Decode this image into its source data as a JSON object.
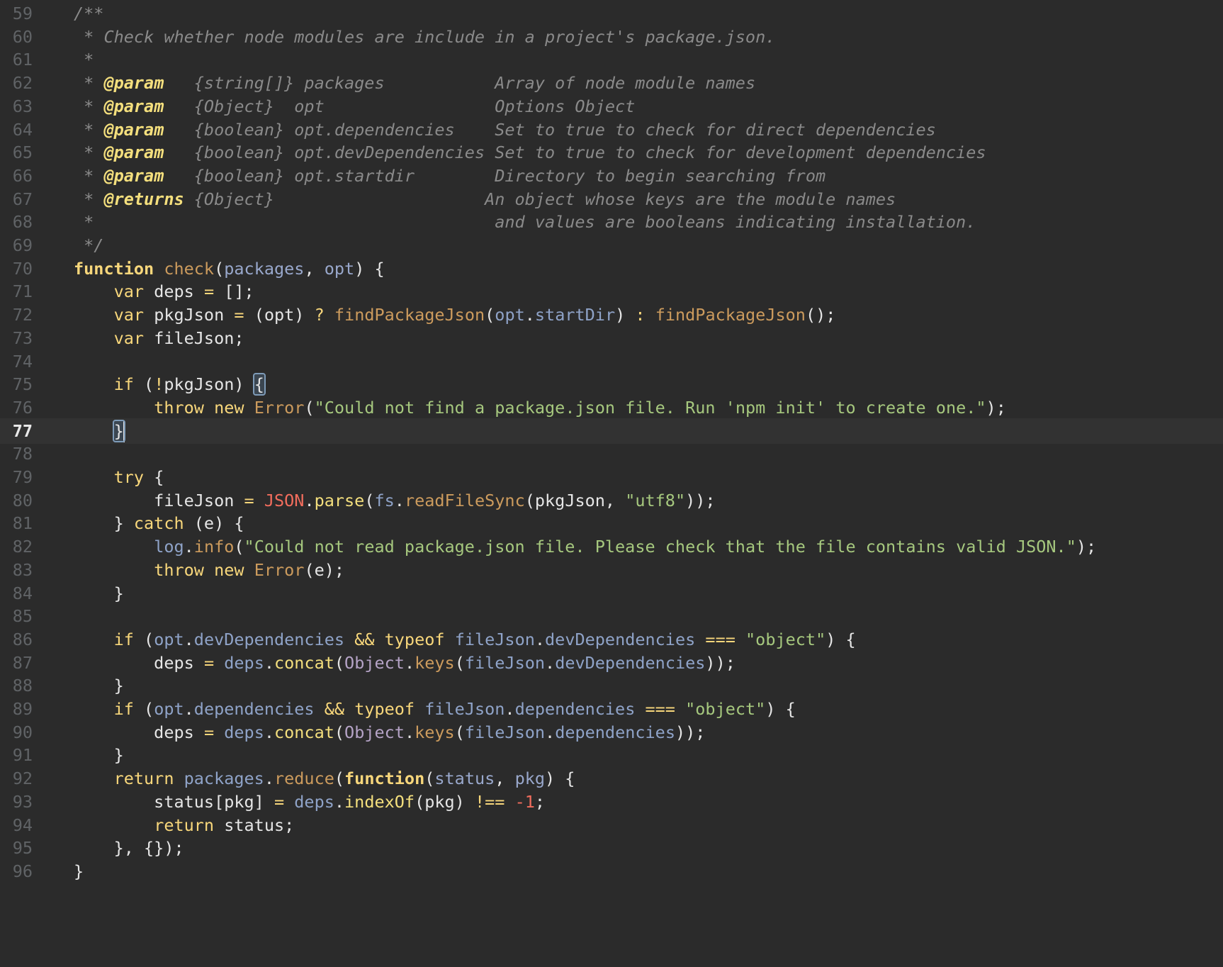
{
  "editor": {
    "current_line": 77,
    "lines": [
      {
        "n": 59,
        "tokens": [
          [
            "cmt",
            "/**"
          ]
        ]
      },
      {
        "n": 60,
        "tokens": [
          [
            "cmt",
            " * Check whether node modules are include in a project's package.json."
          ]
        ]
      },
      {
        "n": 61,
        "tokens": [
          [
            "cmt",
            " *"
          ]
        ]
      },
      {
        "n": 62,
        "tokens": [
          [
            "cmt",
            " * "
          ],
          [
            "tag",
            "@param"
          ],
          [
            "cmt",
            "   {string[]} packages           Array of node module names"
          ]
        ]
      },
      {
        "n": 63,
        "tokens": [
          [
            "cmt",
            " * "
          ],
          [
            "tag",
            "@param"
          ],
          [
            "cmt",
            "   {Object}  opt                 Options Object"
          ]
        ]
      },
      {
        "n": 64,
        "tokens": [
          [
            "cmt",
            " * "
          ],
          [
            "tag",
            "@param"
          ],
          [
            "cmt",
            "   {boolean} opt.dependencies    Set to true to check for direct dependencies"
          ]
        ]
      },
      {
        "n": 65,
        "tokens": [
          [
            "cmt",
            " * "
          ],
          [
            "tag",
            "@param"
          ],
          [
            "cmt",
            "   {boolean} opt.devDependencies Set to true to check for development dependencies"
          ]
        ]
      },
      {
        "n": 66,
        "tokens": [
          [
            "cmt",
            " * "
          ],
          [
            "tag",
            "@param"
          ],
          [
            "cmt",
            "   {boolean} opt.startdir        Directory to begin searching from"
          ]
        ]
      },
      {
        "n": 67,
        "tokens": [
          [
            "cmt",
            " * "
          ],
          [
            "tag",
            "@returns"
          ],
          [
            "cmt",
            " {Object}                     An object whose keys are the module names"
          ]
        ]
      },
      {
        "n": 68,
        "tokens": [
          [
            "cmt",
            " *                                        and values are booleans indicating installation."
          ]
        ]
      },
      {
        "n": 69,
        "tokens": [
          [
            "cmt",
            " */"
          ]
        ]
      },
      {
        "n": 70,
        "tokens": [
          [
            "kwb",
            "function"
          ],
          [
            "",
            " "
          ],
          [
            "fn",
            "check"
          ],
          [
            "",
            "("
          ],
          [
            "param",
            "packages"
          ],
          [
            "",
            ", "
          ],
          [
            "param",
            "opt"
          ],
          [
            "",
            ") {"
          ]
        ]
      },
      {
        "n": 71,
        "tokens": [
          [
            "",
            "    "
          ],
          [
            "kw",
            "var"
          ],
          [
            "",
            " deps "
          ],
          [
            "op",
            "="
          ],
          [
            "",
            " [];"
          ]
        ]
      },
      {
        "n": 72,
        "tokens": [
          [
            "",
            "    "
          ],
          [
            "kw",
            "var"
          ],
          [
            "",
            " pkgJson "
          ],
          [
            "op",
            "="
          ],
          [
            "",
            " (opt) "
          ],
          [
            "op",
            "?"
          ],
          [
            "",
            " "
          ],
          [
            "fn",
            "findPackageJson"
          ],
          [
            "",
            "("
          ],
          [
            "prop",
            "opt"
          ],
          [
            "",
            "."
          ],
          [
            "prop",
            "startDir"
          ],
          [
            "",
            ") "
          ],
          [
            "op",
            ":"
          ],
          [
            "",
            " "
          ],
          [
            "fn",
            "findPackageJson"
          ],
          [
            "",
            "();"
          ]
        ]
      },
      {
        "n": 73,
        "tokens": [
          [
            "",
            "    "
          ],
          [
            "kw",
            "var"
          ],
          [
            "",
            " fileJson;"
          ]
        ]
      },
      {
        "n": 74,
        "tokens": []
      },
      {
        "n": 75,
        "tokens": [
          [
            "",
            "    "
          ],
          [
            "kw",
            "if"
          ],
          [
            "",
            " ("
          ],
          [
            "op",
            "!"
          ],
          [
            "",
            "pkgJson) "
          ],
          [
            "brace",
            "{"
          ]
        ]
      },
      {
        "n": 76,
        "tokens": [
          [
            "",
            "        "
          ],
          [
            "kw",
            "throw"
          ],
          [
            "",
            " "
          ],
          [
            "kw",
            "new"
          ],
          [
            "",
            " "
          ],
          [
            "cls",
            "Error"
          ],
          [
            "",
            "("
          ],
          [
            "str",
            "\"Could not find a package.json file. Run 'npm init' to create one.\""
          ],
          [
            "",
            ");"
          ]
        ]
      },
      {
        "n": 77,
        "tokens": [
          [
            "",
            "    "
          ],
          [
            "brace",
            "}"
          ]
        ]
      },
      {
        "n": 78,
        "tokens": []
      },
      {
        "n": 79,
        "tokens": [
          [
            "",
            "    "
          ],
          [
            "kw",
            "try"
          ],
          [
            "",
            " {"
          ]
        ]
      },
      {
        "n": 80,
        "tokens": [
          [
            "",
            "        fileJson "
          ],
          [
            "op",
            "="
          ],
          [
            "",
            " "
          ],
          [
            "glob",
            "JSON"
          ],
          [
            "",
            "."
          ],
          [
            "meth",
            "parse"
          ],
          [
            "",
            "("
          ],
          [
            "prop",
            "fs"
          ],
          [
            "",
            "."
          ],
          [
            "fn",
            "readFileSync"
          ],
          [
            "",
            "(pkgJson, "
          ],
          [
            "str",
            "\"utf8\""
          ],
          [
            "",
            "));"
          ]
        ]
      },
      {
        "n": 81,
        "tokens": [
          [
            "",
            "    } "
          ],
          [
            "kw",
            "catch"
          ],
          [
            "",
            " (e) {"
          ]
        ]
      },
      {
        "n": 82,
        "tokens": [
          [
            "",
            "        "
          ],
          [
            "prop",
            "log"
          ],
          [
            "",
            "."
          ],
          [
            "fn",
            "info"
          ],
          [
            "",
            "("
          ],
          [
            "str",
            "\"Could not read package.json file. Please check that the file contains valid JSON.\""
          ],
          [
            "",
            ");"
          ]
        ]
      },
      {
        "n": 83,
        "tokens": [
          [
            "",
            "        "
          ],
          [
            "kw",
            "throw"
          ],
          [
            "",
            " "
          ],
          [
            "kw",
            "new"
          ],
          [
            "",
            " "
          ],
          [
            "cls",
            "Error"
          ],
          [
            "",
            "(e);"
          ]
        ]
      },
      {
        "n": 84,
        "tokens": [
          [
            "",
            "    }"
          ]
        ]
      },
      {
        "n": 85,
        "tokens": []
      },
      {
        "n": 86,
        "tokens": [
          [
            "",
            "    "
          ],
          [
            "kw",
            "if"
          ],
          [
            "",
            " ("
          ],
          [
            "prop",
            "opt"
          ],
          [
            "",
            "."
          ],
          [
            "prop",
            "devDependencies"
          ],
          [
            "",
            " "
          ],
          [
            "op",
            "&&"
          ],
          [
            "",
            " "
          ],
          [
            "kw",
            "typeof"
          ],
          [
            "",
            " "
          ],
          [
            "prop",
            "fileJson"
          ],
          [
            "",
            "."
          ],
          [
            "prop",
            "devDependencies"
          ],
          [
            "",
            " "
          ],
          [
            "op",
            "==="
          ],
          [
            "",
            " "
          ],
          [
            "str",
            "\"object\""
          ],
          [
            "",
            ") {"
          ]
        ]
      },
      {
        "n": 87,
        "tokens": [
          [
            "",
            "        deps "
          ],
          [
            "op",
            "="
          ],
          [
            "",
            " "
          ],
          [
            "prop",
            "deps"
          ],
          [
            "",
            "."
          ],
          [
            "meth",
            "concat"
          ],
          [
            "",
            "("
          ],
          [
            "obj",
            "Object"
          ],
          [
            "",
            "."
          ],
          [
            "fn",
            "keys"
          ],
          [
            "",
            "("
          ],
          [
            "prop",
            "fileJson"
          ],
          [
            "",
            "."
          ],
          [
            "prop",
            "devDependencies"
          ],
          [
            "",
            "));"
          ]
        ]
      },
      {
        "n": 88,
        "tokens": [
          [
            "",
            "    }"
          ]
        ]
      },
      {
        "n": 89,
        "tokens": [
          [
            "",
            "    "
          ],
          [
            "kw",
            "if"
          ],
          [
            "",
            " ("
          ],
          [
            "prop",
            "opt"
          ],
          [
            "",
            "."
          ],
          [
            "prop",
            "dependencies"
          ],
          [
            "",
            " "
          ],
          [
            "op",
            "&&"
          ],
          [
            "",
            " "
          ],
          [
            "kw",
            "typeof"
          ],
          [
            "",
            " "
          ],
          [
            "prop",
            "fileJson"
          ],
          [
            "",
            "."
          ],
          [
            "prop",
            "dependencies"
          ],
          [
            "",
            " "
          ],
          [
            "op",
            "==="
          ],
          [
            "",
            " "
          ],
          [
            "str",
            "\"object\""
          ],
          [
            "",
            ") {"
          ]
        ]
      },
      {
        "n": 90,
        "tokens": [
          [
            "",
            "        deps "
          ],
          [
            "op",
            "="
          ],
          [
            "",
            " "
          ],
          [
            "prop",
            "deps"
          ],
          [
            "",
            "."
          ],
          [
            "meth",
            "concat"
          ],
          [
            "",
            "("
          ],
          [
            "obj",
            "Object"
          ],
          [
            "",
            "."
          ],
          [
            "fn",
            "keys"
          ],
          [
            "",
            "("
          ],
          [
            "prop",
            "fileJson"
          ],
          [
            "",
            "."
          ],
          [
            "prop",
            "dependencies"
          ],
          [
            "",
            "));"
          ]
        ]
      },
      {
        "n": 91,
        "tokens": [
          [
            "",
            "    }"
          ]
        ]
      },
      {
        "n": 92,
        "tokens": [
          [
            "",
            "    "
          ],
          [
            "kw",
            "return"
          ],
          [
            "",
            " "
          ],
          [
            "prop",
            "packages"
          ],
          [
            "",
            "."
          ],
          [
            "fn",
            "reduce"
          ],
          [
            "",
            "("
          ],
          [
            "kwb",
            "function"
          ],
          [
            "",
            "("
          ],
          [
            "param",
            "status"
          ],
          [
            "",
            ", "
          ],
          [
            "param",
            "pkg"
          ],
          [
            "",
            ") {"
          ]
        ]
      },
      {
        "n": 93,
        "tokens": [
          [
            "",
            "        status[pkg] "
          ],
          [
            "op",
            "="
          ],
          [
            "",
            " "
          ],
          [
            "prop",
            "deps"
          ],
          [
            "",
            "."
          ],
          [
            "meth",
            "indexOf"
          ],
          [
            "",
            "(pkg) "
          ],
          [
            "op",
            "!=="
          ],
          [
            "",
            " "
          ],
          [
            "num",
            "-1"
          ],
          [
            "",
            ";"
          ]
        ]
      },
      {
        "n": 94,
        "tokens": [
          [
            "",
            "        "
          ],
          [
            "kw",
            "return"
          ],
          [
            "",
            " status;"
          ]
        ]
      },
      {
        "n": 95,
        "tokens": [
          [
            "",
            "    }, {});"
          ]
        ]
      },
      {
        "n": 96,
        "tokens": [
          [
            "",
            "}"
          ]
        ]
      }
    ]
  }
}
